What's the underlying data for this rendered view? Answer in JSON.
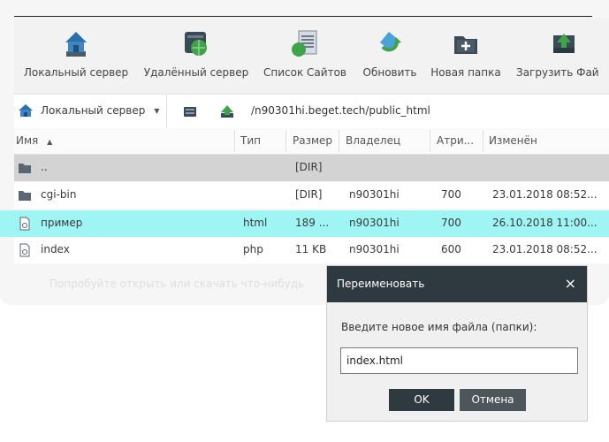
{
  "toolbar": {
    "buttons": [
      {
        "label": "Локальный сервер",
        "icon": "home-server-icon"
      },
      {
        "label": "Удалённый сервер",
        "icon": "remote-server-icon"
      },
      {
        "label": "Список Сайтов",
        "icon": "site-list-icon"
      },
      {
        "label": "Обновить",
        "icon": "refresh-icon"
      },
      {
        "label": "Новая папка",
        "icon": "new-folder-icon"
      },
      {
        "label": "Загрузить Фай",
        "icon": "upload-file-icon"
      }
    ]
  },
  "pathbar": {
    "server_label": "Локальный сервер",
    "path": "/n90301hi.beget.tech/public_html"
  },
  "table": {
    "columns": [
      "Имя",
      "Тип",
      "Размер",
      "Владелец",
      "Атри...",
      "Изменён"
    ],
    "sort_indicator": "▲",
    "rows": [
      {
        "name": "..",
        "type": "",
        "size": "[DIR]",
        "owner": "",
        "attrs": "",
        "modified": "",
        "icon": "folder-icon"
      },
      {
        "name": "cgi-bin",
        "type": "",
        "size": "[DIR]",
        "owner": "n90301hi",
        "attrs": "700",
        "modified": "23.01.2018 08:52...",
        "icon": "folder-icon"
      },
      {
        "name": "пример",
        "type": "html",
        "size": "189 ...",
        "owner": "n90301hi",
        "attrs": "700",
        "modified": "26.10.2018 11:00...",
        "icon": "file-icon"
      },
      {
        "name": "index",
        "type": "php",
        "size": "11 KB",
        "owner": "n90301hi",
        "attrs": "600",
        "modified": "23.01.2018 08:52...",
        "icon": "file-icon"
      }
    ]
  },
  "background_hint": "Попробуйте открыть или скачать что-нибудь",
  "dialog": {
    "title": "Переименовать",
    "close_glyph": "×",
    "prompt": "Введите новое имя файла (папки):",
    "input_value": "index.html",
    "ok_label": "OK",
    "cancel_label": "Отмена"
  },
  "colors": {
    "selected_row": "#9ff4f4",
    "parent_row": "#d3d3d3",
    "dialog_header": "#2f3a40"
  }
}
